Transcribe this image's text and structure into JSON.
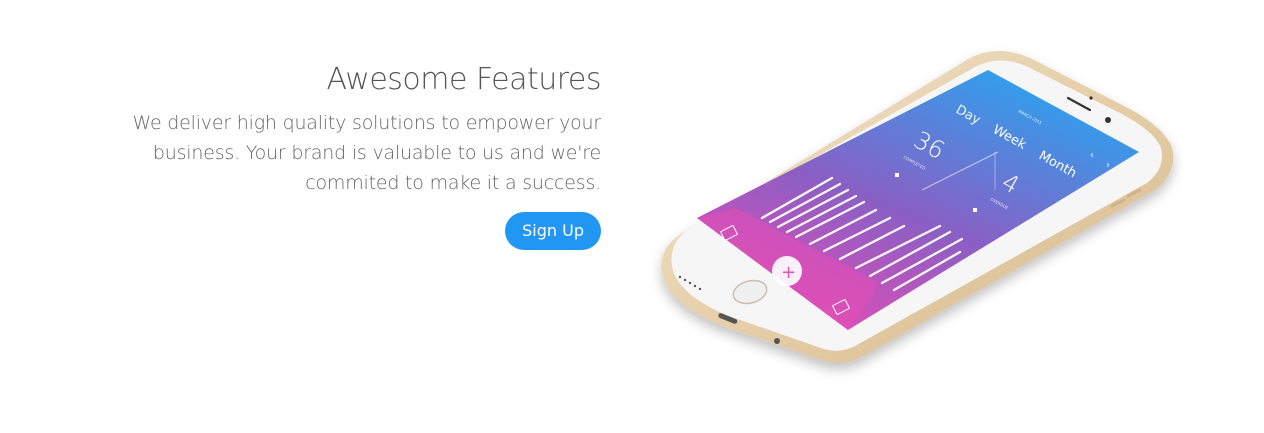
{
  "features": {
    "title": "Awesome Features",
    "lines": [
      "We deliver high quality solutions to empower your",
      "business. Your brand is valuable to us and we're",
      "commited to make it a success."
    ],
    "cta_label": "Sign Up"
  },
  "phone_app": {
    "header_month": "MARCH 2015",
    "tabs": [
      "Day",
      "Week",
      "Month"
    ],
    "stats": [
      {
        "value": "36",
        "label": "COMPLETED"
      },
      {
        "value": "4",
        "label": "OVERDUE"
      }
    ],
    "add_glyph": "+"
  },
  "colors": {
    "accent": "#2196f3",
    "gradient_top": "#22a9f3",
    "gradient_mid": "#8a5fc4",
    "gradient_bottom": "#ec4bb4",
    "phone_body": "#e8d3b2"
  }
}
